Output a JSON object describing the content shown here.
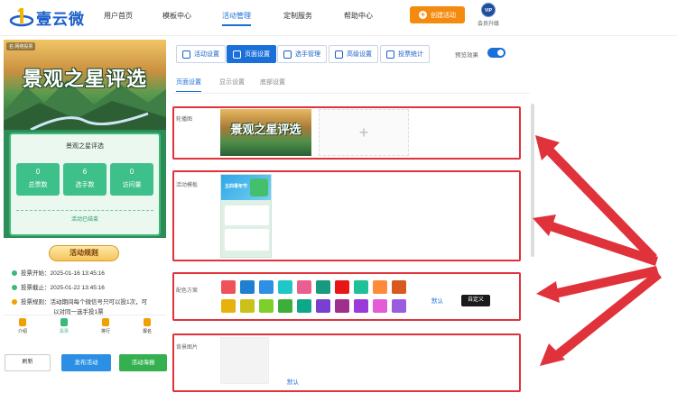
{
  "header": {
    "brand": "壹云微",
    "nav": [
      {
        "label": "用户首页"
      },
      {
        "label": "模板中心"
      },
      {
        "label": "活动管理"
      },
      {
        "label": "定制服务"
      },
      {
        "label": "帮助中心"
      }
    ],
    "create_label": "创建活动",
    "vip_badge": "VIP",
    "vip_label": "会员升级"
  },
  "phone": {
    "hero_tag": "名 网络投票",
    "hero_title": "景观之星评选",
    "stats_title": "景观之星评选",
    "stats": [
      {
        "value": "0",
        "label": "总票数"
      },
      {
        "value": "6",
        "label": "选手数"
      },
      {
        "value": "0",
        "label": "访问量"
      }
    ],
    "ended_text": "活动已结束",
    "rules_title": "活动规则",
    "rules": [
      "投票开始：2025-01-16 13:45:16",
      "投票截止：2025-01-22 13:45:16",
      "投票规则：活动期间每个微信号只可以投1次，可",
      "以对同一选手投1票"
    ],
    "tabs": [
      {
        "label": "介绍",
        "color": "#f0a000"
      },
      {
        "label": "投票",
        "color": "#3cb878"
      },
      {
        "label": "排行",
        "color": "#f0a000"
      },
      {
        "label": "报名",
        "color": "#f0a000"
      }
    ]
  },
  "actions": {
    "refresh": "刷新",
    "publish": "发布活动",
    "preview": "活动海报"
  },
  "toolbar": {
    "buttons": [
      {
        "label": "活动设置"
      },
      {
        "label": "页面设置"
      },
      {
        "label": "选手管理"
      },
      {
        "label": "高级设置"
      },
      {
        "label": "投票统计"
      }
    ],
    "preview_label": "预览效果"
  },
  "subtabs": [
    {
      "label": "页面设置"
    },
    {
      "label": "显示设置"
    },
    {
      "label": "底部设置"
    }
  ],
  "sections": {
    "carousel_label": "轮播图",
    "carousel_thumb_title": "景观之星评选",
    "add_symbol": "+",
    "template_label": "活动模板",
    "template_thumb_title": "五四青年节",
    "color_label": "配色方案",
    "default_label": "默认",
    "custom_label": "自定义",
    "bg_label": "背景图片",
    "bg_default_label": "默认"
  },
  "palette": [
    [
      "#f0525a",
      "#1f7fd0",
      "#2f8fe5",
      "#20c7c8",
      "#e95f90",
      "#179a7f",
      "#e81616",
      "#20c09a",
      "#ff8a3c",
      "#d8581f"
    ],
    [
      "#e8b20a",
      "#c9c21a",
      "#7fcf2a",
      "#3cae3a",
      "#0fa78a",
      "#7a3fd0",
      "#a02f8c",
      "#9a3ad8",
      "#e45bd8",
      "#9b5de0"
    ]
  ],
  "colors": {
    "accent": "#1a6fd8",
    "orange": "#f58a10",
    "highlight": "#e0323a"
  }
}
